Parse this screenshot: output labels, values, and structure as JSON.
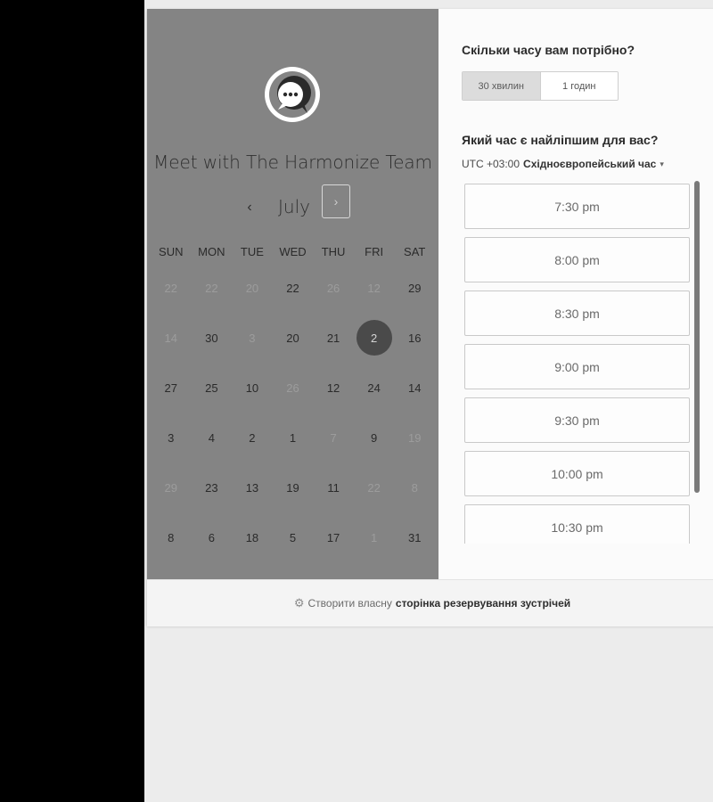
{
  "header": {
    "title": "Meet with The Harmonize Team"
  },
  "calendar": {
    "prev_icon": "‹",
    "month": "July",
    "next_icon": "›",
    "weekdays": [
      "SUN",
      "MON",
      "TUE",
      "WED",
      "THU",
      "FRI",
      "SAT"
    ],
    "weeks": [
      [
        {
          "d": "22",
          "dim": true
        },
        {
          "d": "22",
          "dim": true
        },
        {
          "d": "20",
          "dim": true
        },
        {
          "d": "22",
          "dim": false
        },
        {
          "d": "26",
          "dim": true
        },
        {
          "d": "12",
          "dim": true
        },
        {
          "d": "29",
          "dim": false
        }
      ],
      [
        {
          "d": "14",
          "dim": true
        },
        {
          "d": "30",
          "dim": false
        },
        {
          "d": "3",
          "dim": true
        },
        {
          "d": "20",
          "dim": false
        },
        {
          "d": "21",
          "dim": false
        },
        {
          "d": "2",
          "dim": false,
          "selected": true
        },
        {
          "d": "16",
          "dim": false
        }
      ],
      [
        {
          "d": "27",
          "dim": false
        },
        {
          "d": "25",
          "dim": false
        },
        {
          "d": "10",
          "dim": false
        },
        {
          "d": "26",
          "dim": true
        },
        {
          "d": "12",
          "dim": false
        },
        {
          "d": "24",
          "dim": false
        },
        {
          "d": "14",
          "dim": false
        }
      ],
      [
        {
          "d": "3",
          "dim": false
        },
        {
          "d": "4",
          "dim": false
        },
        {
          "d": "2",
          "dim": false
        },
        {
          "d": "1",
          "dim": false
        },
        {
          "d": "7",
          "dim": true
        },
        {
          "d": "9",
          "dim": false
        },
        {
          "d": "19",
          "dim": true
        }
      ],
      [
        {
          "d": "29",
          "dim": true
        },
        {
          "d": "23",
          "dim": false
        },
        {
          "d": "13",
          "dim": false
        },
        {
          "d": "19",
          "dim": false
        },
        {
          "d": "11",
          "dim": false
        },
        {
          "d": "22",
          "dim": true
        },
        {
          "d": "8",
          "dim": true
        }
      ],
      [
        {
          "d": "8",
          "dim": false
        },
        {
          "d": "6",
          "dim": false
        },
        {
          "d": "18",
          "dim": false
        },
        {
          "d": "5",
          "dim": false
        },
        {
          "d": "17",
          "dim": false
        },
        {
          "d": "1",
          "dim": true
        },
        {
          "d": "31",
          "dim": false
        }
      ]
    ]
  },
  "duration": {
    "question": "Скільки часу вам потрібно?",
    "options": [
      "30 хвилин",
      "1 годин"
    ],
    "selected": "30 хвилин"
  },
  "time": {
    "question": "Який час є найліпшим для вас?",
    "tz_offset": "UTC +03:00",
    "tz_name": "Східноєвропейський час",
    "tz_caret": "▾",
    "slots": [
      "7:30 pm",
      "8:00 pm",
      "8:30 pm",
      "9:00 pm",
      "9:30 pm",
      "10:00 pm",
      "10:30 pm"
    ]
  },
  "footer": {
    "icon": "sprocket-icon",
    "prefix": "Створити власну",
    "link": "сторінка резервування зустрічей"
  },
  "colors": {
    "left_panel": "#848484",
    "selected_day": "#4a4a4a",
    "page_background": "#ececec"
  }
}
